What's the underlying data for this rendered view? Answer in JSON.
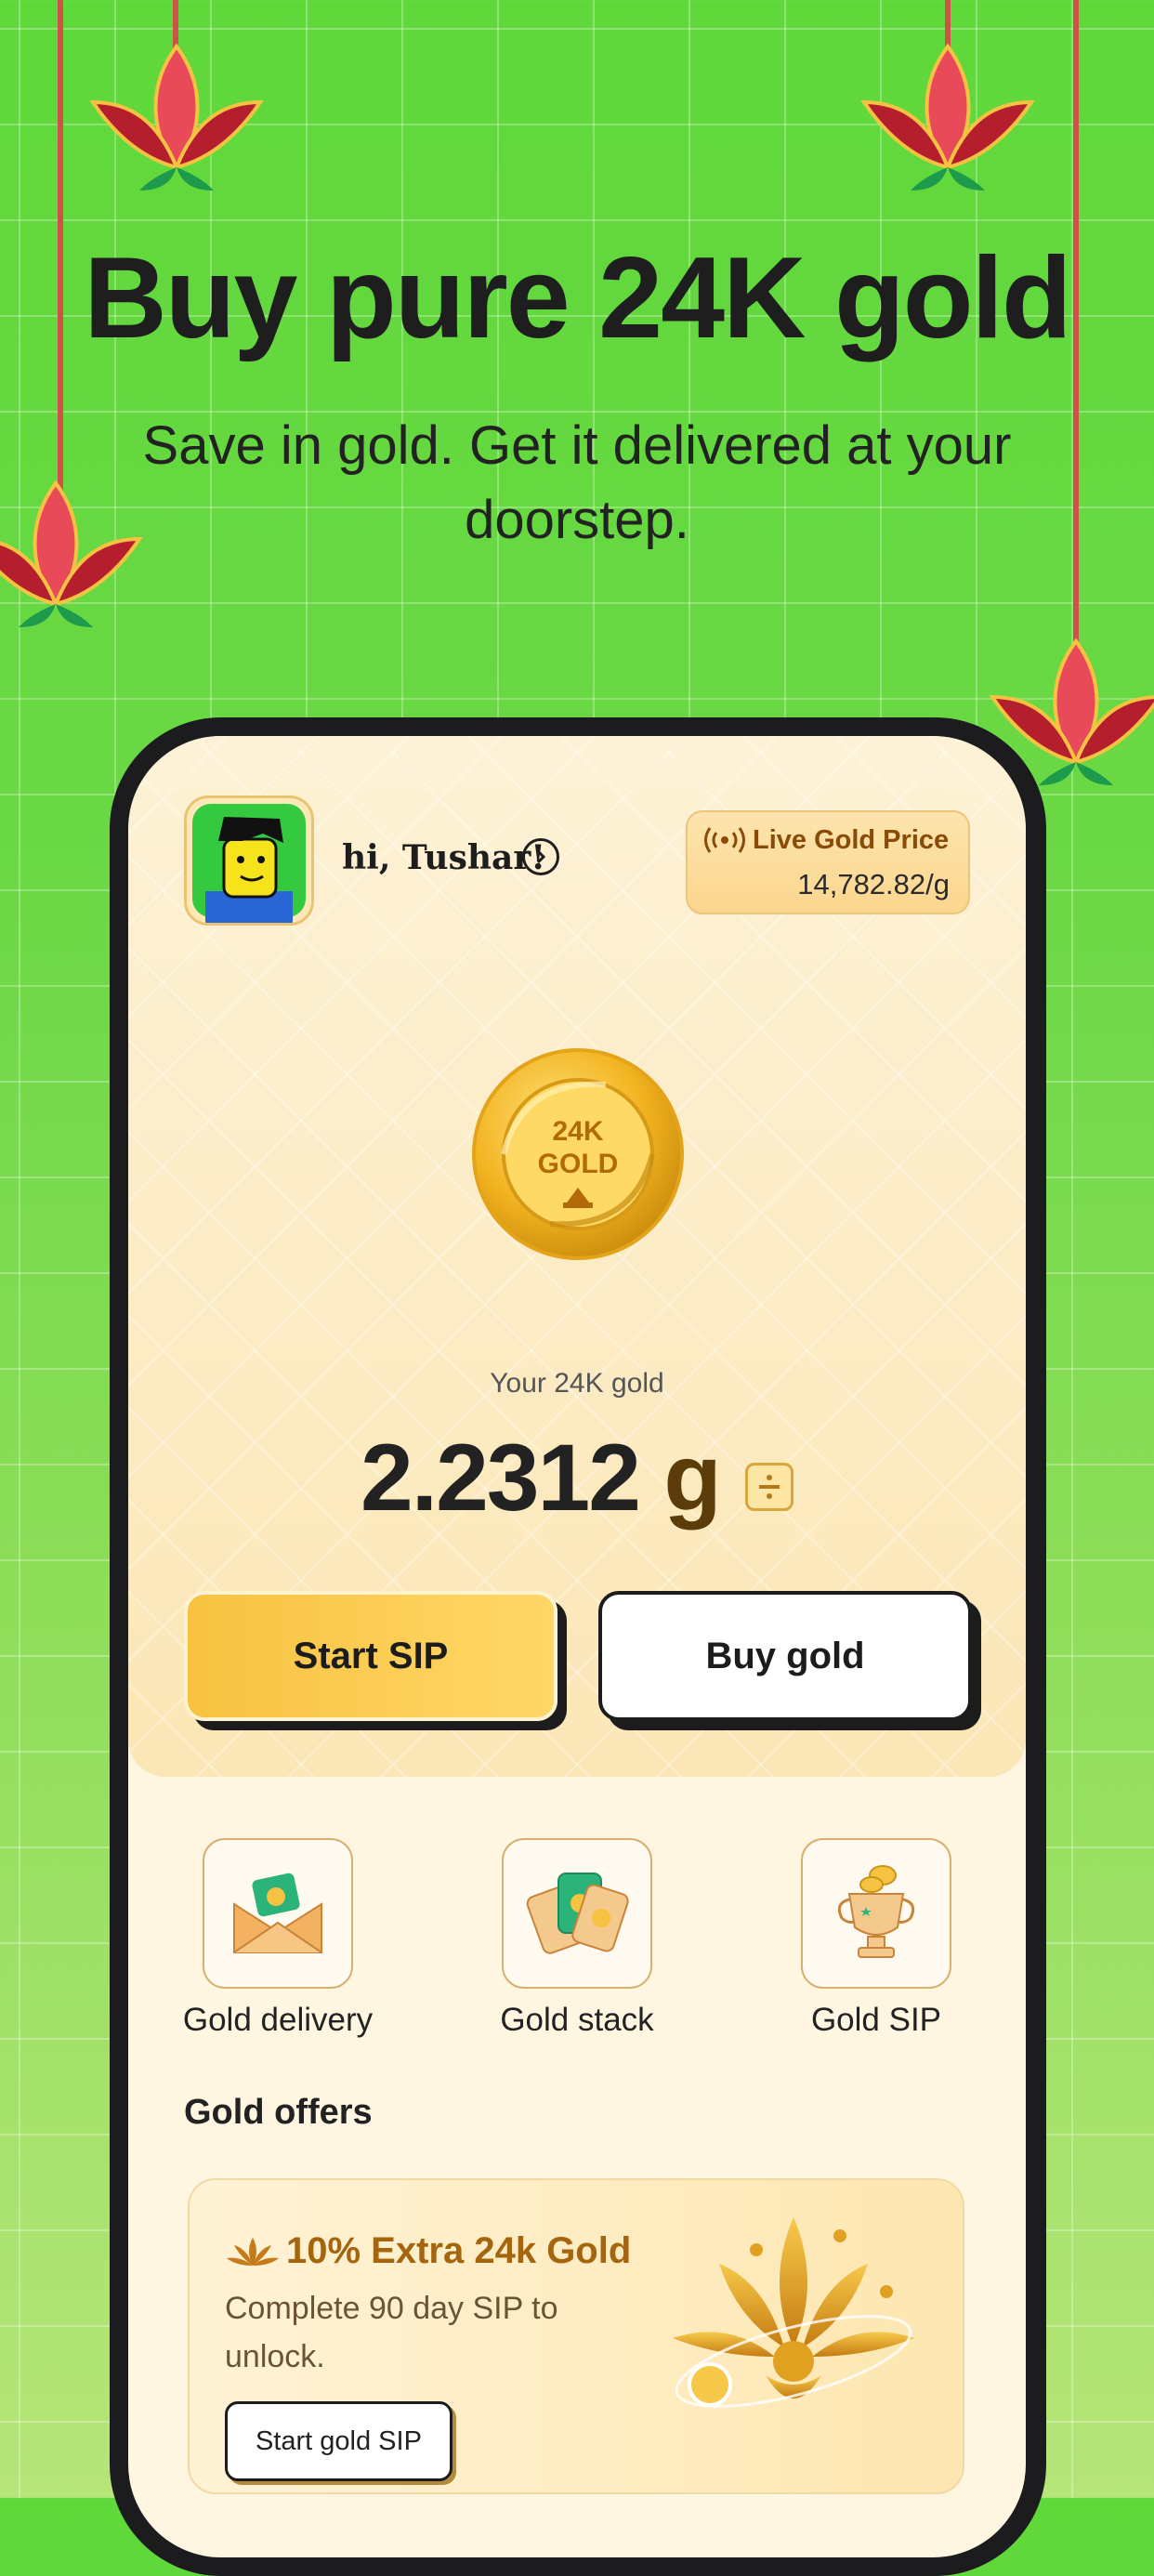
{
  "banner": {
    "headline": "Buy pure 24K gold",
    "subheadline": "Save in gold. Get it delivered at your doorstep."
  },
  "header": {
    "greeting": "hi, Tushar!",
    "live_price": {
      "title": "Live Gold Price",
      "value": "14,782.82/g"
    }
  },
  "balance": {
    "coin_line1": "24K",
    "coin_line2": "GOLD",
    "label": "Your 24K gold",
    "amount": "2.2312",
    "unit": "g"
  },
  "actions": {
    "primary": "Start SIP",
    "secondary": "Buy gold"
  },
  "quick_links": [
    {
      "label": "Gold delivery",
      "icon": "envelope-icon"
    },
    {
      "label": "Gold stack",
      "icon": "cards-icon"
    },
    {
      "label": "Gold SIP",
      "icon": "trophy-icon"
    }
  ],
  "offers": {
    "title": "Gold offers",
    "card": {
      "heading": "10% Extra 24k Gold",
      "description": "Complete 90 day SIP to unlock.",
      "button": "Start gold SIP"
    }
  },
  "colors": {
    "background_green": "#66d640",
    "gold": "#f5b82e",
    "cream": "#fff6e2",
    "offer_text": "#a5650f"
  }
}
